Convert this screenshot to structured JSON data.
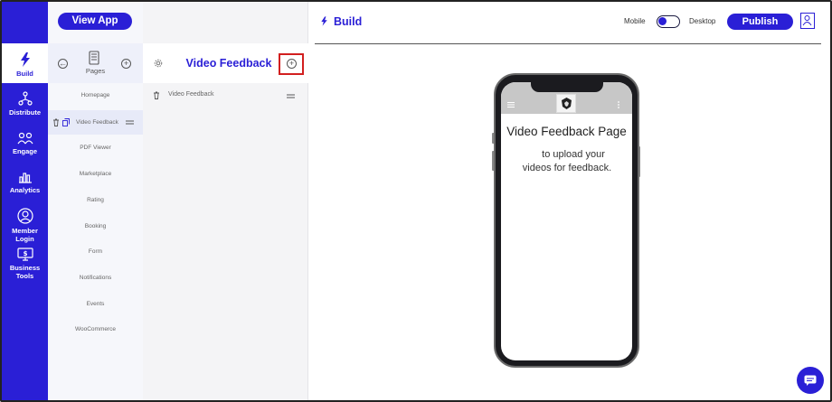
{
  "nav": {
    "items": [
      {
        "label": "Build",
        "icon": "lightning-icon"
      },
      {
        "label": "Distribute",
        "icon": "network-icon"
      },
      {
        "label": "Engage",
        "icon": "people-icon"
      },
      {
        "label": "Analytics",
        "icon": "bar-chart-icon"
      },
      {
        "label": "Member Login",
        "icon": "user-circle-icon"
      },
      {
        "label": "Business Tools",
        "icon": "monitor-dollar-icon"
      }
    ]
  },
  "pages": {
    "view_app_label": "View App",
    "header_label": "Pages",
    "items": [
      "Homepage",
      "Video Feedback",
      "PDF Viewer",
      "Marketplace",
      "Rating",
      "Booking",
      "Form",
      "Notifications",
      "Events",
      "WooCommerce"
    ]
  },
  "subpages": {
    "title": "Video Feedback",
    "items": [
      "Video Feedback"
    ]
  },
  "main": {
    "title": "Build",
    "mode_mobile": "Mobile",
    "mode_desktop": "Desktop",
    "publish_label": "Publish"
  },
  "preview": {
    "page_title": "Video Feedback Page",
    "body_line1": "to upload your",
    "body_line2": "videos for feedback."
  },
  "colors": {
    "brand": "#2a1fd6",
    "highlight": "#d21f1f"
  }
}
